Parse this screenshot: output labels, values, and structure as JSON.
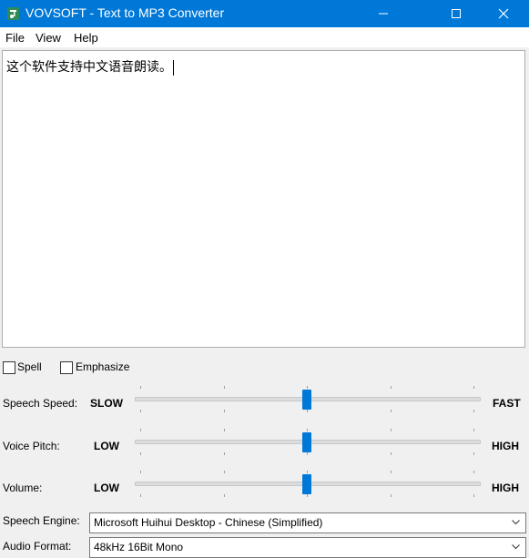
{
  "window": {
    "title": "VOVSOFT - Text to MP3 Converter"
  },
  "menu": {
    "file": "File",
    "view": "View",
    "help": "Help"
  },
  "editor": {
    "text": "这个软件支持中文语音朗读。"
  },
  "options": {
    "spell": "Spell",
    "emphasize": "Emphasize",
    "spell_checked": false,
    "emphasize_checked": false
  },
  "sliders": {
    "speed": {
      "label": "Speech Speed:",
      "min": "SLOW",
      "max": "FAST",
      "value": 0.5
    },
    "pitch": {
      "label": "Voice Pitch:",
      "min": "LOW",
      "max": "HIGH",
      "value": 0.5
    },
    "volume": {
      "label": "Volume:",
      "min": "LOW",
      "max": "HIGH",
      "value": 0.5
    }
  },
  "engine": {
    "label": "Speech Engine:",
    "value": "Microsoft Huihui Desktop - Chinese (Simplified)"
  },
  "format": {
    "label": "Audio Format:",
    "value": "48kHz 16Bit Mono"
  },
  "colors": {
    "titlebar": "#0078d7",
    "accent": "#0078d7"
  }
}
